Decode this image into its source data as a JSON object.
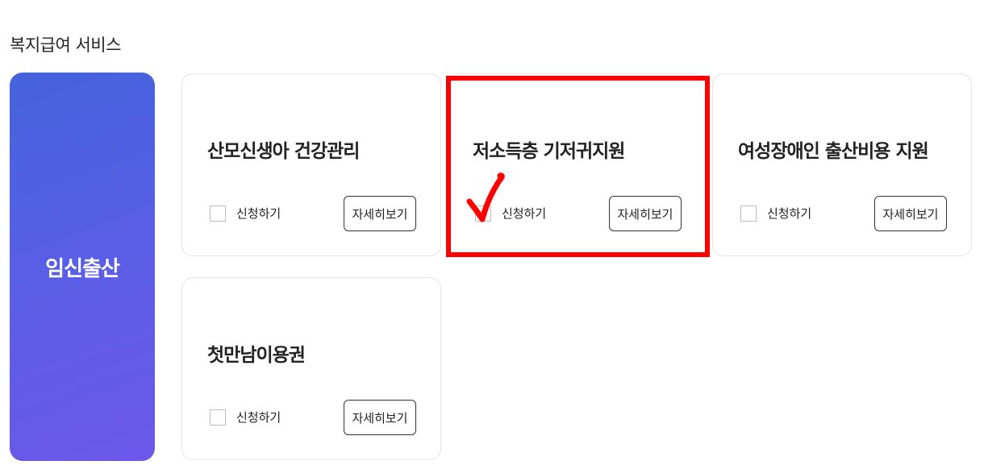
{
  "section": {
    "title": "복지급여 서비스"
  },
  "category": {
    "label": "임신출산",
    "gradient_start": "#4563dc",
    "gradient_end": "#6d58ea"
  },
  "cards": [
    {
      "title": "산모신생아 건강관리",
      "apply_label": "신청하기",
      "apply_checked": false,
      "detail_label": "자세히보기"
    },
    {
      "title": "저소득층 기저귀지원",
      "apply_label": "신청하기",
      "apply_checked": false,
      "detail_label": "자세히보기"
    },
    {
      "title": "여성장애인 출산비용 지원",
      "apply_label": "신청하기",
      "apply_checked": false,
      "detail_label": "자세히보기"
    },
    {
      "title": "첫만남이용권",
      "apply_label": "신청하기",
      "apply_checked": false,
      "detail_label": "자세히보기"
    }
  ],
  "annotation": {
    "highlight_color": "#ff0000",
    "highlighted_card": "저소득층 기저귀지원",
    "mark_icon": "checkmark-icon"
  }
}
